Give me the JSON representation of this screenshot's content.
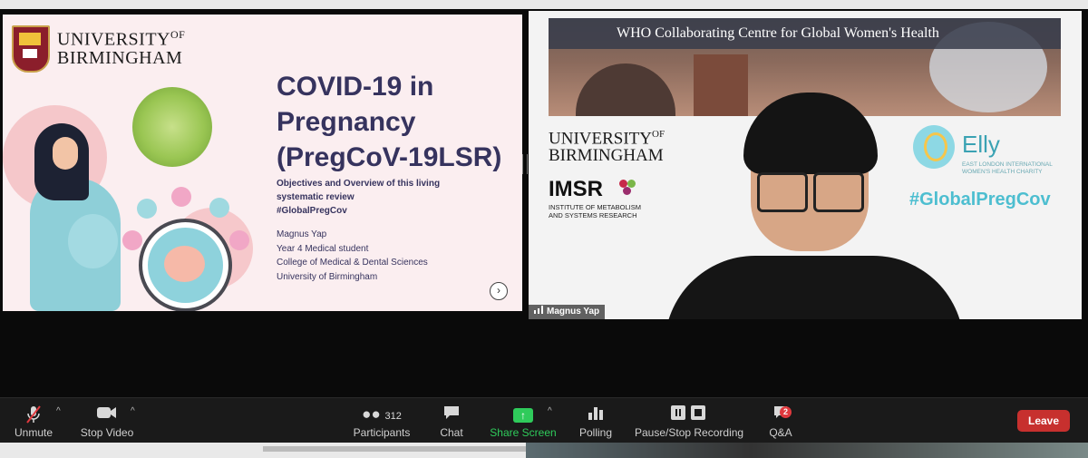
{
  "slide": {
    "university": "UNIVERSITY",
    "university_of": "OF",
    "university_name": "BIRMINGHAM",
    "title": "COVID-19 in Pregnancy (PregCoV-19LSR)",
    "subtitle_lines": [
      "Objectives and Overview of this living",
      "systematic review",
      "#GlobalPregCov"
    ],
    "author_lines": [
      "Magnus Yap",
      "Year 4 Medical student",
      "College of Medical & Dental Sciences",
      "University of Birmingham"
    ],
    "next_icon": "chevron-right-icon"
  },
  "video": {
    "banner_title": "WHO Collaborating Centre for Global Women's Health",
    "uob_university": "UNIVERSITY",
    "uob_of": "OF",
    "uob_name": "BIRMINGHAM",
    "imsr": "IMSR",
    "imsr_sub_1": "INSTITUTE OF METABOLISM",
    "imsr_sub_2": "AND SYSTEMS RESEARCH",
    "elly": "Elly",
    "elly_sub_1": "EAST LONDON INTERNATIONAL",
    "elly_sub_2": "WOMEN'S HEALTH CHARITY",
    "hashtag": "#GlobalPregCov",
    "participant_name": "Magnus Yap"
  },
  "toolbar": {
    "unmute": "Unmute",
    "stop_video": "Stop Video",
    "participants": "Participants",
    "participants_count": "312",
    "chat": "Chat",
    "share_screen": "Share Screen",
    "polling": "Polling",
    "record": "Pause/Stop Recording",
    "qa": "Q&A",
    "qa_badge": "2",
    "leave": "Leave"
  },
  "colors": {
    "share_green": "#2fcb5b",
    "leave_red": "#c7302e",
    "slide_title": "#36335e"
  }
}
